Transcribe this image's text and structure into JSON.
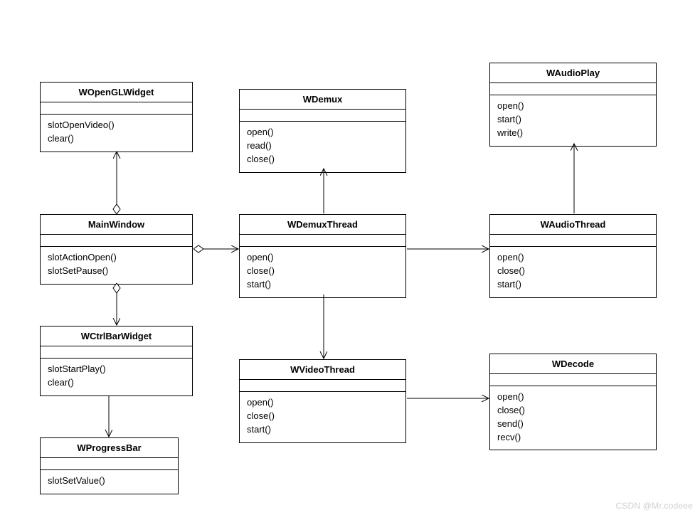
{
  "boxes": {
    "wopengl": {
      "title": "WOpenGLWidget",
      "methods": [
        "slotOpenVideo()",
        "clear()"
      ]
    },
    "mainwindow": {
      "title": "MainWindow",
      "methods": [
        "slotActionOpen()",
        "slotSetPause()"
      ]
    },
    "wctrlbar": {
      "title": "WCtrlBarWidget",
      "methods": [
        "slotStartPlay()",
        "clear()"
      ]
    },
    "wprogress": {
      "title": "WProgressBar",
      "methods": [
        "slotSetValue()"
      ]
    },
    "wdemux": {
      "title": "WDemux",
      "methods": [
        "open()",
        "read()",
        "close()"
      ]
    },
    "wdemuxthr": {
      "title": "WDemuxThread",
      "methods": [
        "open()",
        "close()",
        "start()"
      ]
    },
    "wvideothr": {
      "title": "WVideoThread",
      "methods": [
        "open()",
        "close()",
        "start()"
      ]
    },
    "waudioplay": {
      "title": "WAudioPlay",
      "methods": [
        "open()",
        "start()",
        "write()"
      ]
    },
    "waudiothr": {
      "title": "WAudioThread",
      "methods": [
        "open()",
        "close()",
        "start()"
      ]
    },
    "wdecode": {
      "title": "WDecode",
      "methods": [
        "open()",
        "close()",
        "send()",
        "recv()"
      ]
    }
  },
  "watermark": "CSDN @Mr.codeee",
  "chart_data": {
    "type": "uml-class-diagram",
    "classes": [
      {
        "name": "WOpenGLWidget",
        "methods": [
          "slotOpenVideo()",
          "clear()"
        ]
      },
      {
        "name": "MainWindow",
        "methods": [
          "slotActionOpen()",
          "slotSetPause()"
        ]
      },
      {
        "name": "WCtrlBarWidget",
        "methods": [
          "slotStartPlay()",
          "clear()"
        ]
      },
      {
        "name": "WProgressBar",
        "methods": [
          "slotSetValue()"
        ]
      },
      {
        "name": "WDemux",
        "methods": [
          "open()",
          "read()",
          "close()"
        ]
      },
      {
        "name": "WDemuxThread",
        "methods": [
          "open()",
          "close()",
          "start()"
        ]
      },
      {
        "name": "WVideoThread",
        "methods": [
          "open()",
          "close()",
          "start()"
        ]
      },
      {
        "name": "WAudioPlay",
        "methods": [
          "open()",
          "start()",
          "write()"
        ]
      },
      {
        "name": "WAudioThread",
        "methods": [
          "open()",
          "close()",
          "start()"
        ]
      },
      {
        "name": "WDecode",
        "methods": [
          "open()",
          "close()",
          "send()",
          "recv()"
        ]
      }
    ],
    "relationships": [
      {
        "from": "MainWindow",
        "to": "WOpenGLWidget",
        "type": "aggregation"
      },
      {
        "from": "MainWindow",
        "to": "WCtrlBarWidget",
        "type": "aggregation"
      },
      {
        "from": "MainWindow",
        "to": "WDemuxThread",
        "type": "aggregation-association"
      },
      {
        "from": "WCtrlBarWidget",
        "to": "WProgressBar",
        "type": "association"
      },
      {
        "from": "WDemuxThread",
        "to": "WDemux",
        "type": "association"
      },
      {
        "from": "WDemuxThread",
        "to": "WVideoThread",
        "type": "association"
      },
      {
        "from": "WDemuxThread",
        "to": "WAudioThread",
        "type": "association"
      },
      {
        "from": "WAudioThread",
        "to": "WAudioPlay",
        "type": "association"
      },
      {
        "from": "WVideoThread",
        "to": "WDecode",
        "type": "association"
      }
    ]
  }
}
